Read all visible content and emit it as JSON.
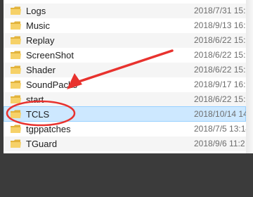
{
  "file_list": {
    "rows": [
      {
        "name": "Logs",
        "modified": "2018/7/31 15:"
      },
      {
        "name": "Music",
        "modified": "2018/9/13 16:"
      },
      {
        "name": "Replay",
        "modified": "2018/6/22 15:"
      },
      {
        "name": "ScreenShot",
        "modified": "2018/6/22 15:2"
      },
      {
        "name": "Shader",
        "modified": "2018/6/22 15:2"
      },
      {
        "name": "SoundPacks",
        "modified": "2018/9/17 16:"
      },
      {
        "name": "start",
        "modified": "2018/6/22 15:2"
      },
      {
        "name": "TCLS",
        "modified": "2018/10/14 14"
      },
      {
        "name": "tgppatches",
        "modified": "2018/7/5 13:14"
      },
      {
        "name": "TGuard",
        "modified": "2018/9/6 11:2"
      }
    ],
    "selected_row": "TCLS"
  },
  "annotation": {
    "arrow_color": "#e8322e",
    "circle_color": "#e8322e"
  }
}
